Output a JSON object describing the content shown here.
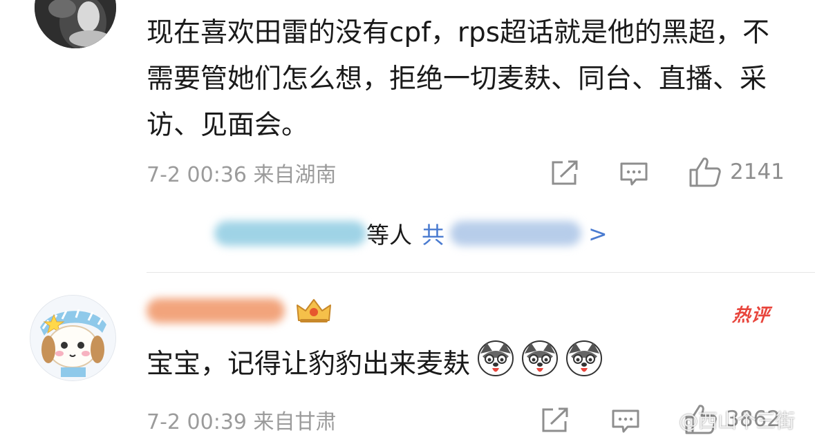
{
  "comments": [
    {
      "text": "现在喜欢田雷的没有cpf，rps超话就是他的黑超，不需要管她们怎么想，拒绝一切麦麸、同台、直播、采访、见面会。",
      "meta": "7-2 00:36 来自湖南",
      "like_count": "2141",
      "replies": {
        "mid_text": "等人",
        "share_text": "共",
        "chevron": ">"
      }
    },
    {
      "hot_badge": "热评",
      "text": "宝宝，记得让豹豹出来麦麸",
      "emoji_name": "husky-emoji",
      "meta": "7-2 00:39 来自甘肃",
      "like_count": "3862"
    }
  ],
  "watermark": "@西山个三街",
  "colors": {
    "meta": "#9b9b9b",
    "link": "#4a7bd0",
    "hot": "#e8453c",
    "divider": "#e6e6e6"
  }
}
